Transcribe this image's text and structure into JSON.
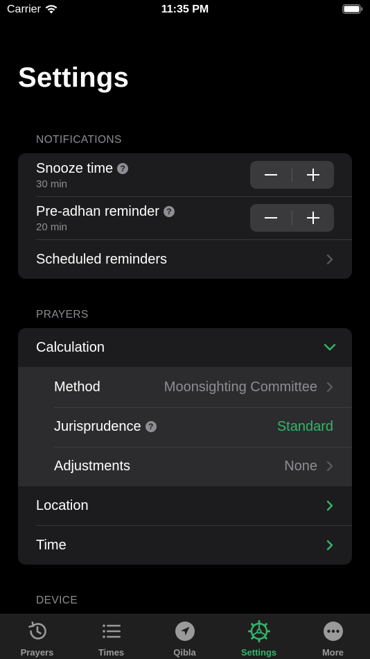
{
  "status_bar": {
    "carrier": "Carrier",
    "time": "11:35 PM"
  },
  "page": {
    "title": "Settings"
  },
  "notifications": {
    "header": "NOTIFICATIONS",
    "snooze": {
      "title": "Snooze time",
      "value": "30 min"
    },
    "preadhan": {
      "title": "Pre-adhan reminder",
      "value": "20 min"
    },
    "scheduled": {
      "title": "Scheduled reminders"
    }
  },
  "prayers": {
    "header": "PRAYERS",
    "calculation": {
      "title": "Calculation"
    },
    "method": {
      "title": "Method",
      "value": "Moonsighting Committee"
    },
    "jurisprudence": {
      "title": "Jurisprudence",
      "value": "Standard"
    },
    "adjustments": {
      "title": "Adjustments",
      "value": "None"
    },
    "location": {
      "title": "Location"
    },
    "time": {
      "title": "Time"
    }
  },
  "device": {
    "header": "DEVICE"
  },
  "tabs": [
    {
      "label": "Prayers",
      "icon": "history-icon"
    },
    {
      "label": "Times",
      "icon": "list-icon"
    },
    {
      "label": "Qibla",
      "icon": "compass-icon"
    },
    {
      "label": "Settings",
      "icon": "gear-icon",
      "active": true
    },
    {
      "label": "More",
      "icon": "more-icon"
    }
  ],
  "colors": {
    "accent": "#33b56a",
    "background": "#000000",
    "cell": "#1c1c1e",
    "subcell": "#2c2c2e",
    "secondary_text": "#8d8d93"
  }
}
